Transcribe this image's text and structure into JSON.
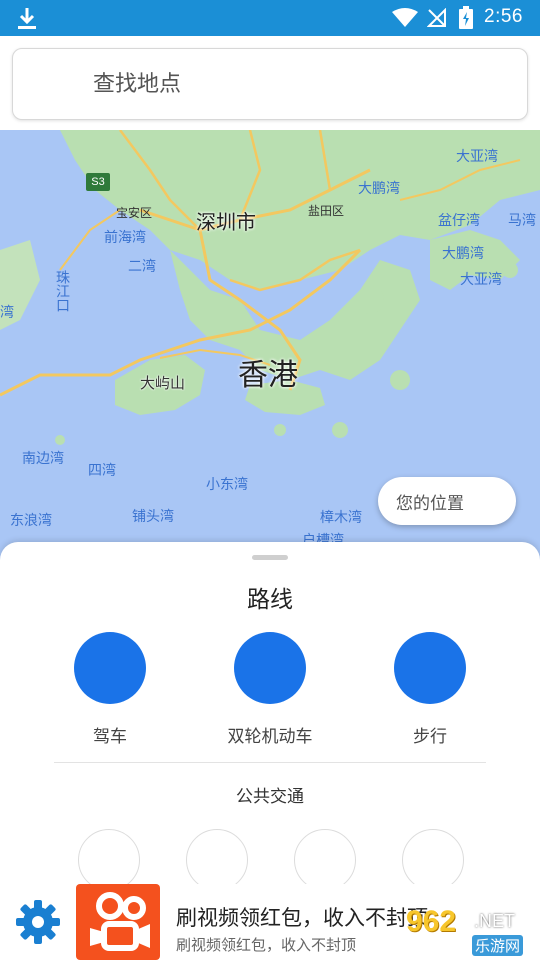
{
  "status_bar": {
    "time": "2:56"
  },
  "search": {
    "placeholder": "查找地点"
  },
  "map": {
    "labels": {
      "shenzhen": "深圳市",
      "hongkong": "香港",
      "lantau": "大屿山",
      "baoan": "宝安区",
      "yantian": "盐田区",
      "qianhaiwan": "前海湾",
      "erwan": "二湾",
      "zhujiangkou": "珠江口",
      "dapengwan_top": "大鹏湾",
      "dayawan_1": "大亚湾",
      "dayawan_2": "大亚湾",
      "yizaiwan": "盆仔湾",
      "mawan": "马湾",
      "dapengwan_2": "大鹏湾",
      "nanbianwan": "南边湾",
      "siwan": "四湾",
      "xiaodongwan": "小东湾",
      "dongliangwan": "东浪湾",
      "putouwan": "铺头湾",
      "zhangmuwan": "樟木湾",
      "hubiwan": "户槽湾",
      "wan_left": "湾",
      "route_shield": "S3"
    },
    "my_location": "您的位置"
  },
  "sheet": {
    "title": "路线",
    "modes": [
      {
        "label": "驾车"
      },
      {
        "label": "双轮机动车"
      },
      {
        "label": "步行"
      }
    ],
    "transit_title": "公共交通"
  },
  "ad": {
    "title": "刷视频领红包，收入不封顶",
    "subtitle": "刷视频领红包，收入不封顶"
  },
  "watermark": {
    "number": "962",
    "domain": ".NET",
    "name": "乐游网"
  },
  "colors": {
    "status_bar": "#1b8fd6",
    "accent": "#1a73e8",
    "water": "#a9c6f5",
    "land": "#b9dfb1"
  }
}
